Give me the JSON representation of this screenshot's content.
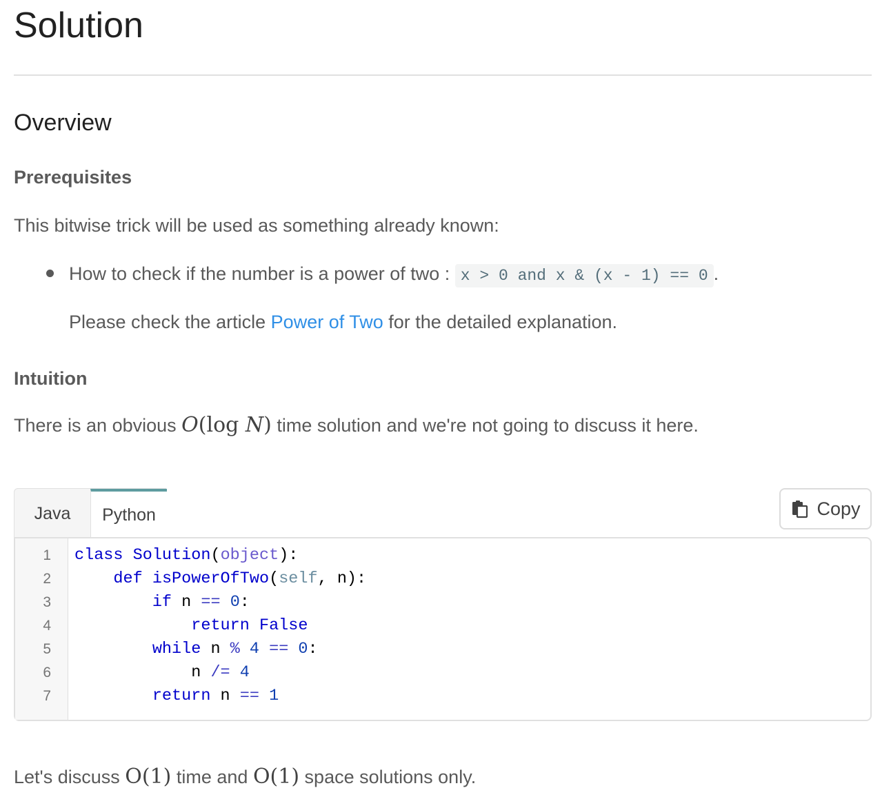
{
  "title": "Solution",
  "overview": {
    "heading": "Overview"
  },
  "prerequisites": {
    "heading": "Prerequisites",
    "intro": "This bitwise trick will be used as something already known:",
    "bullet_text": "How to check if the number is a power of two :",
    "bullet_code": "x > 0 and x & (x - 1) == 0",
    "bullet_end": ".",
    "article_before": "Please check the article",
    "article_link": "Power of Two",
    "article_after": "for the detailed explanation."
  },
  "intuition": {
    "heading": "Intuition",
    "text_before": "There is an obvious",
    "math_O": "O",
    "math_log": "(log",
    "math_N": "N",
    "math_close": ")",
    "text_after": "time solution and we're not going to discuss it here."
  },
  "code_block": {
    "tabs": [
      "Java",
      "Python"
    ],
    "selected_tab": "Python",
    "copy_label": "Copy",
    "line_numbers": [
      "1",
      "2",
      "3",
      "4",
      "5",
      "6",
      "7"
    ],
    "lines": [
      "class Solution(object):",
      "    def isPowerOfTwo(self, n):",
      "        if n == 0:",
      "            return False",
      "        while n % 4 == 0:",
      "            n /= 4",
      "        return n == 1"
    ]
  },
  "closing": {
    "text_1": "Let's discuss",
    "math_1": "O(1)",
    "text_2": "time and",
    "math_2": "O(1)",
    "text_3": "space solutions only."
  }
}
